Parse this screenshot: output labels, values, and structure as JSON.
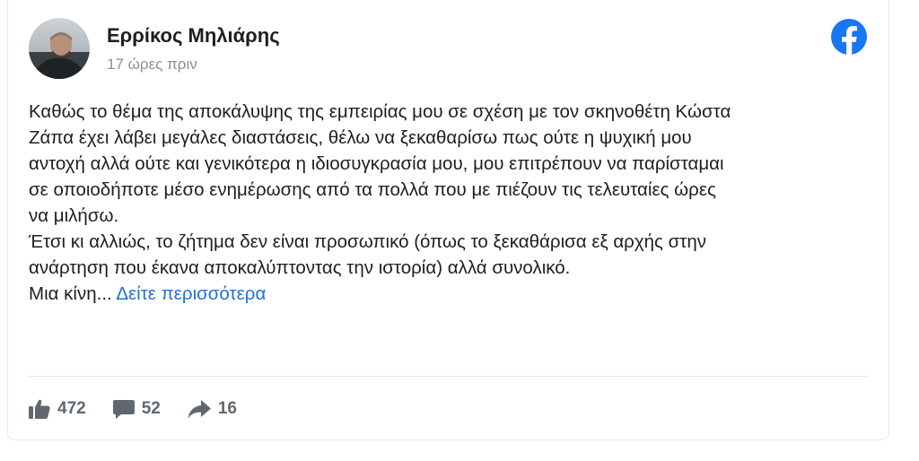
{
  "post": {
    "author": {
      "name": "Ερρίκος Μηλιάρης",
      "avatar_icon": "profile-photo"
    },
    "timestamp": "17 ώρες πριν",
    "platform_icon": "facebook-logo-icon",
    "brand_color": "#1877f2",
    "link_color": "#216fdb",
    "body_lines": [
      "Καθώς το θέμα της αποκάλυψης της εμπειρίας μου σε σχέση με τον σκηνοθέτη Κώστα",
      "Ζάπα έχει λάβει μεγάλες διαστάσεις, θέλω να ξεκαθαρίσω πως ούτε η ψυχική μου",
      "αντοχή αλλά ούτε και γενικότερα η ιδιοσυγκρασία μου, μου επιτρέπουν να παρίσταμαι",
      "σε οποιοδήποτε μέσο ενημέρωσης από τα πολλά που με πιέζουν τις τελευταίες ώρες",
      "να μιλήσω.",
      "Έτσι κι αλλιώς, το ζήτημα δεν είναι προσωπικό (όπως το ξεκαθάρισα εξ αρχής στην",
      "ανάρτηση που έκανα αποκαλύπτοντας την ιστορία) αλλά συνολικό."
    ],
    "truncated_text": "Μια κίνη...",
    "see_more_label": "Δείτε περισσότερα"
  },
  "engagement": {
    "likes": {
      "icon": "thumbs-up-icon",
      "count": "472"
    },
    "comments": {
      "icon": "comment-icon",
      "count": "52"
    },
    "shares": {
      "icon": "share-arrow-icon",
      "count": "16"
    }
  }
}
